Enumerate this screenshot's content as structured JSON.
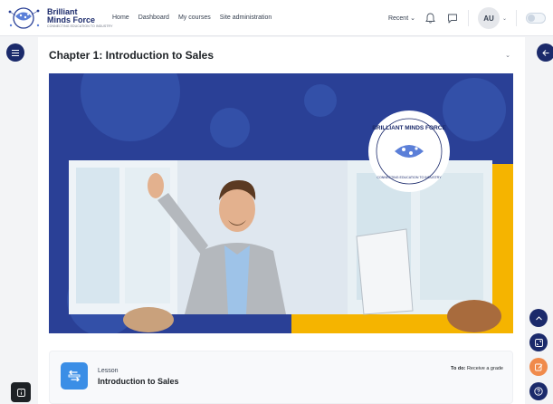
{
  "brand": {
    "name_line1": "Brilliant",
    "name_line2": "Minds Force",
    "tagline": "CONNECTING EDUCATION TO INDUSTRY"
  },
  "nav": {
    "links": [
      "Home",
      "Dashboard",
      "My courses",
      "Site administration"
    ],
    "recent_label": "Recent"
  },
  "user": {
    "initials": "AU"
  },
  "section": {
    "title": "Chapter 1: Introduction to Sales"
  },
  "banner": {
    "badge_top": "BRILLIANT MINDS FORCE",
    "badge_bottom": "CONNECTING EDUCATION TO INDUSTRY",
    "colors": {
      "background": "#2a4096",
      "accent": "#f5b400",
      "navy": "#1b2a6b"
    }
  },
  "activity": {
    "type": "Lesson",
    "title": "Introduction to Sales",
    "todo_label": "To do:",
    "todo_value": "Receive a grade",
    "icon": "lesson-icon"
  },
  "colors": {
    "navy": "#1b2a6b",
    "lesson_blue": "#3b8ee6",
    "edit_orange": "#f08a4b"
  }
}
